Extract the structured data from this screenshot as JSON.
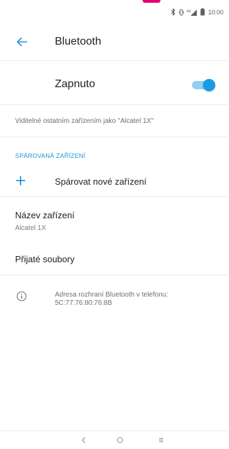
{
  "status_bar": {
    "time": "10:00",
    "network": "4G",
    "icons": [
      "bluetooth-icon",
      "vibrate-icon",
      "signal-icon",
      "battery-icon"
    ]
  },
  "toolbar": {
    "title": "Bluetooth",
    "back_icon": "arrow-back-icon"
  },
  "master_switch": {
    "label": "Zapnuto",
    "state": "on"
  },
  "visibility_text": "Viditelné ostatním zařízením jako \"Alcatel 1X\"",
  "paired_section": {
    "header": "SPÁROVANÁ ZAŘÍZENÍ",
    "pair_new_label": "Spárovat nové zařízení"
  },
  "device_name": {
    "title": "Název zařízení",
    "value": "Alcatel 1X"
  },
  "received_files": {
    "label": "Přijaté soubory"
  },
  "info": {
    "text": "Adresa rozhraní Bluetooth v telefonu: 5C:77:76:80:76:8B"
  },
  "nav_bar": {
    "back_icon": "nav-back-icon",
    "home_icon": "nav-home-icon",
    "recent_icon": "nav-recent-icon"
  },
  "colors": {
    "accent": "#2196d3",
    "toggle_thumb": "#1a9be6",
    "toggle_track": "#8fd0f2",
    "brand_marker": "#e20074"
  }
}
